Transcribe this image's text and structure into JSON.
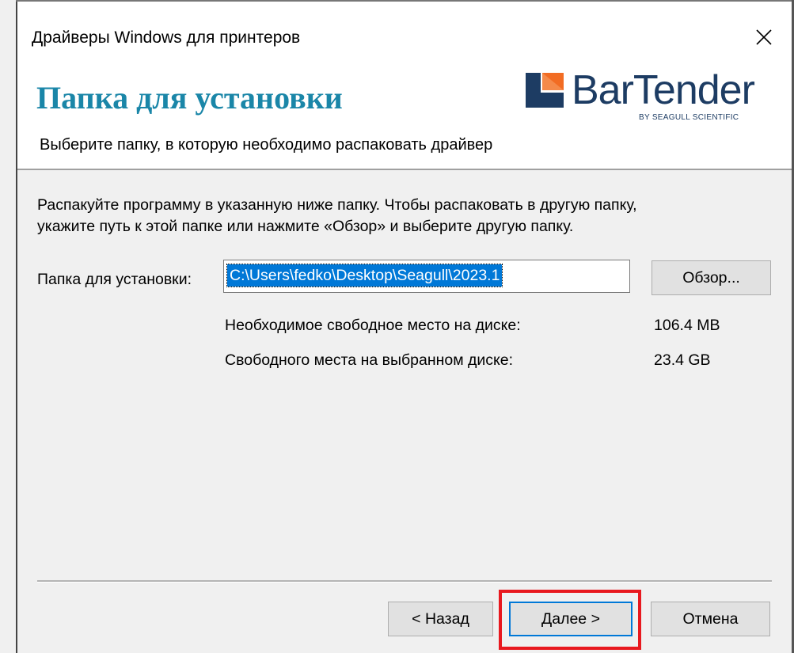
{
  "window": {
    "title": "Драйверы Windows для принтеров",
    "close_symbol": "✕"
  },
  "header": {
    "heading": "Папка для установки",
    "subtitle": "Выберите папку, в которую необходимо распаковать драйвер",
    "logo": {
      "name": "BarTender",
      "byline": "BY SEAGULL SCIENTIFIC",
      "icon": "bartender-logo-icon",
      "colors": {
        "navy": "#1d3c63",
        "orange": "#f26c23"
      }
    },
    "heading_color": "#1a86a8"
  },
  "body": {
    "instructions_line1": "Распакуйте программу в указанную ниже папку. Чтобы распаковать в другую папку,",
    "instructions_line2": "укажите путь к этой папке или нажмите «Обзор» и выберите  другую папку.",
    "folder_label": "Папка для установки:",
    "folder_path": "C:\\Users\\fedko\\Desktop\\Seagull\\2023.1",
    "browse_label": "Обзор...",
    "required_space_label": "Необходимое свободное место на диске:",
    "required_space_value": "106.4 MB",
    "free_space_label": "Свободного места на выбранном диске:",
    "free_space_value": "23.4 GB"
  },
  "footer": {
    "back_label": "< Назад",
    "next_label": "Далее >",
    "cancel_label": "Отмена"
  },
  "annotation": {
    "highlight_color": "#e8191f"
  }
}
